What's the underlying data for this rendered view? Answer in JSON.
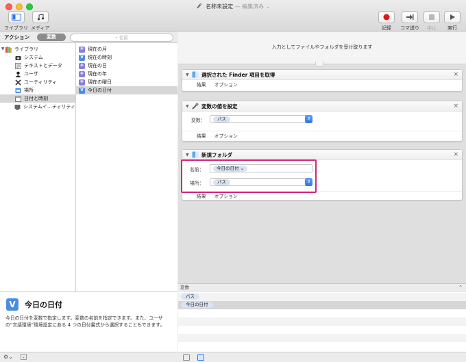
{
  "window": {
    "title": "名称未設定",
    "status": "— 編集済み ⌄"
  },
  "toolbar": {
    "library_label": "ライブラリ",
    "media_label": "メディア",
    "record_label": "記録",
    "step_label": "コマ送り",
    "stop_label": "中止",
    "run_label": "実行"
  },
  "library": {
    "tab_actions": "アクション",
    "tab_variables": "変数",
    "search_placeholder": "名前",
    "categories": [
      {
        "label": "ライブラリ",
        "icon": "library-icon"
      },
      {
        "label": "システム",
        "icon": "camera-icon"
      },
      {
        "label": "テキストとデータ",
        "icon": "text-icon"
      },
      {
        "label": "ユーザ",
        "icon": "user-icon"
      },
      {
        "label": "ユーティリティ",
        "icon": "tools-icon"
      },
      {
        "label": "場所",
        "icon": "location-icon"
      },
      {
        "label": "日付と時刻",
        "icon": "calendar-icon"
      },
      {
        "label": "システムイ…ティリティ",
        "icon": "system-utility-icon"
      }
    ],
    "variables": [
      {
        "label": "現在の月",
        "icon": "gear"
      },
      {
        "label": "現在の時刻",
        "icon": "v"
      },
      {
        "label": "現在の日",
        "icon": "gear"
      },
      {
        "label": "現在の年",
        "icon": "gear"
      },
      {
        "label": "現在の曜日",
        "icon": "gear"
      },
      {
        "label": "今日の日付",
        "icon": "v"
      }
    ]
  },
  "description": {
    "icon_letter": "V",
    "title": "今日の日付",
    "text": "今日の日付を変数で指定します。変数の名前を指定できます。また、ユーザの“言語環境”環境設定にある 4 つの日付書式から選択することもできます。"
  },
  "workflow": {
    "input_text": "入力としてファイルやフォルダを受け取ります",
    "actions": [
      {
        "title": "選択された Finder 項目を取得",
        "results": "結果",
        "options": "オプション"
      },
      {
        "title": "変数の値を設定",
        "var_label": "変数：",
        "var_value": "パス",
        "results": "結果",
        "options": "オプション"
      },
      {
        "title": "新規フォルダ",
        "name_label": "名前：",
        "name_value": "今日の日付 ⌄",
        "place_label": "場所：",
        "place_value": "パス",
        "results": "結果",
        "options": "オプション"
      }
    ]
  },
  "variables_panel": {
    "header": "変数",
    "items": [
      "パス",
      "今日の日付"
    ]
  },
  "colors": {
    "accent": "#2e76e8",
    "highlight": "#d1267b",
    "record": "#e01818"
  }
}
